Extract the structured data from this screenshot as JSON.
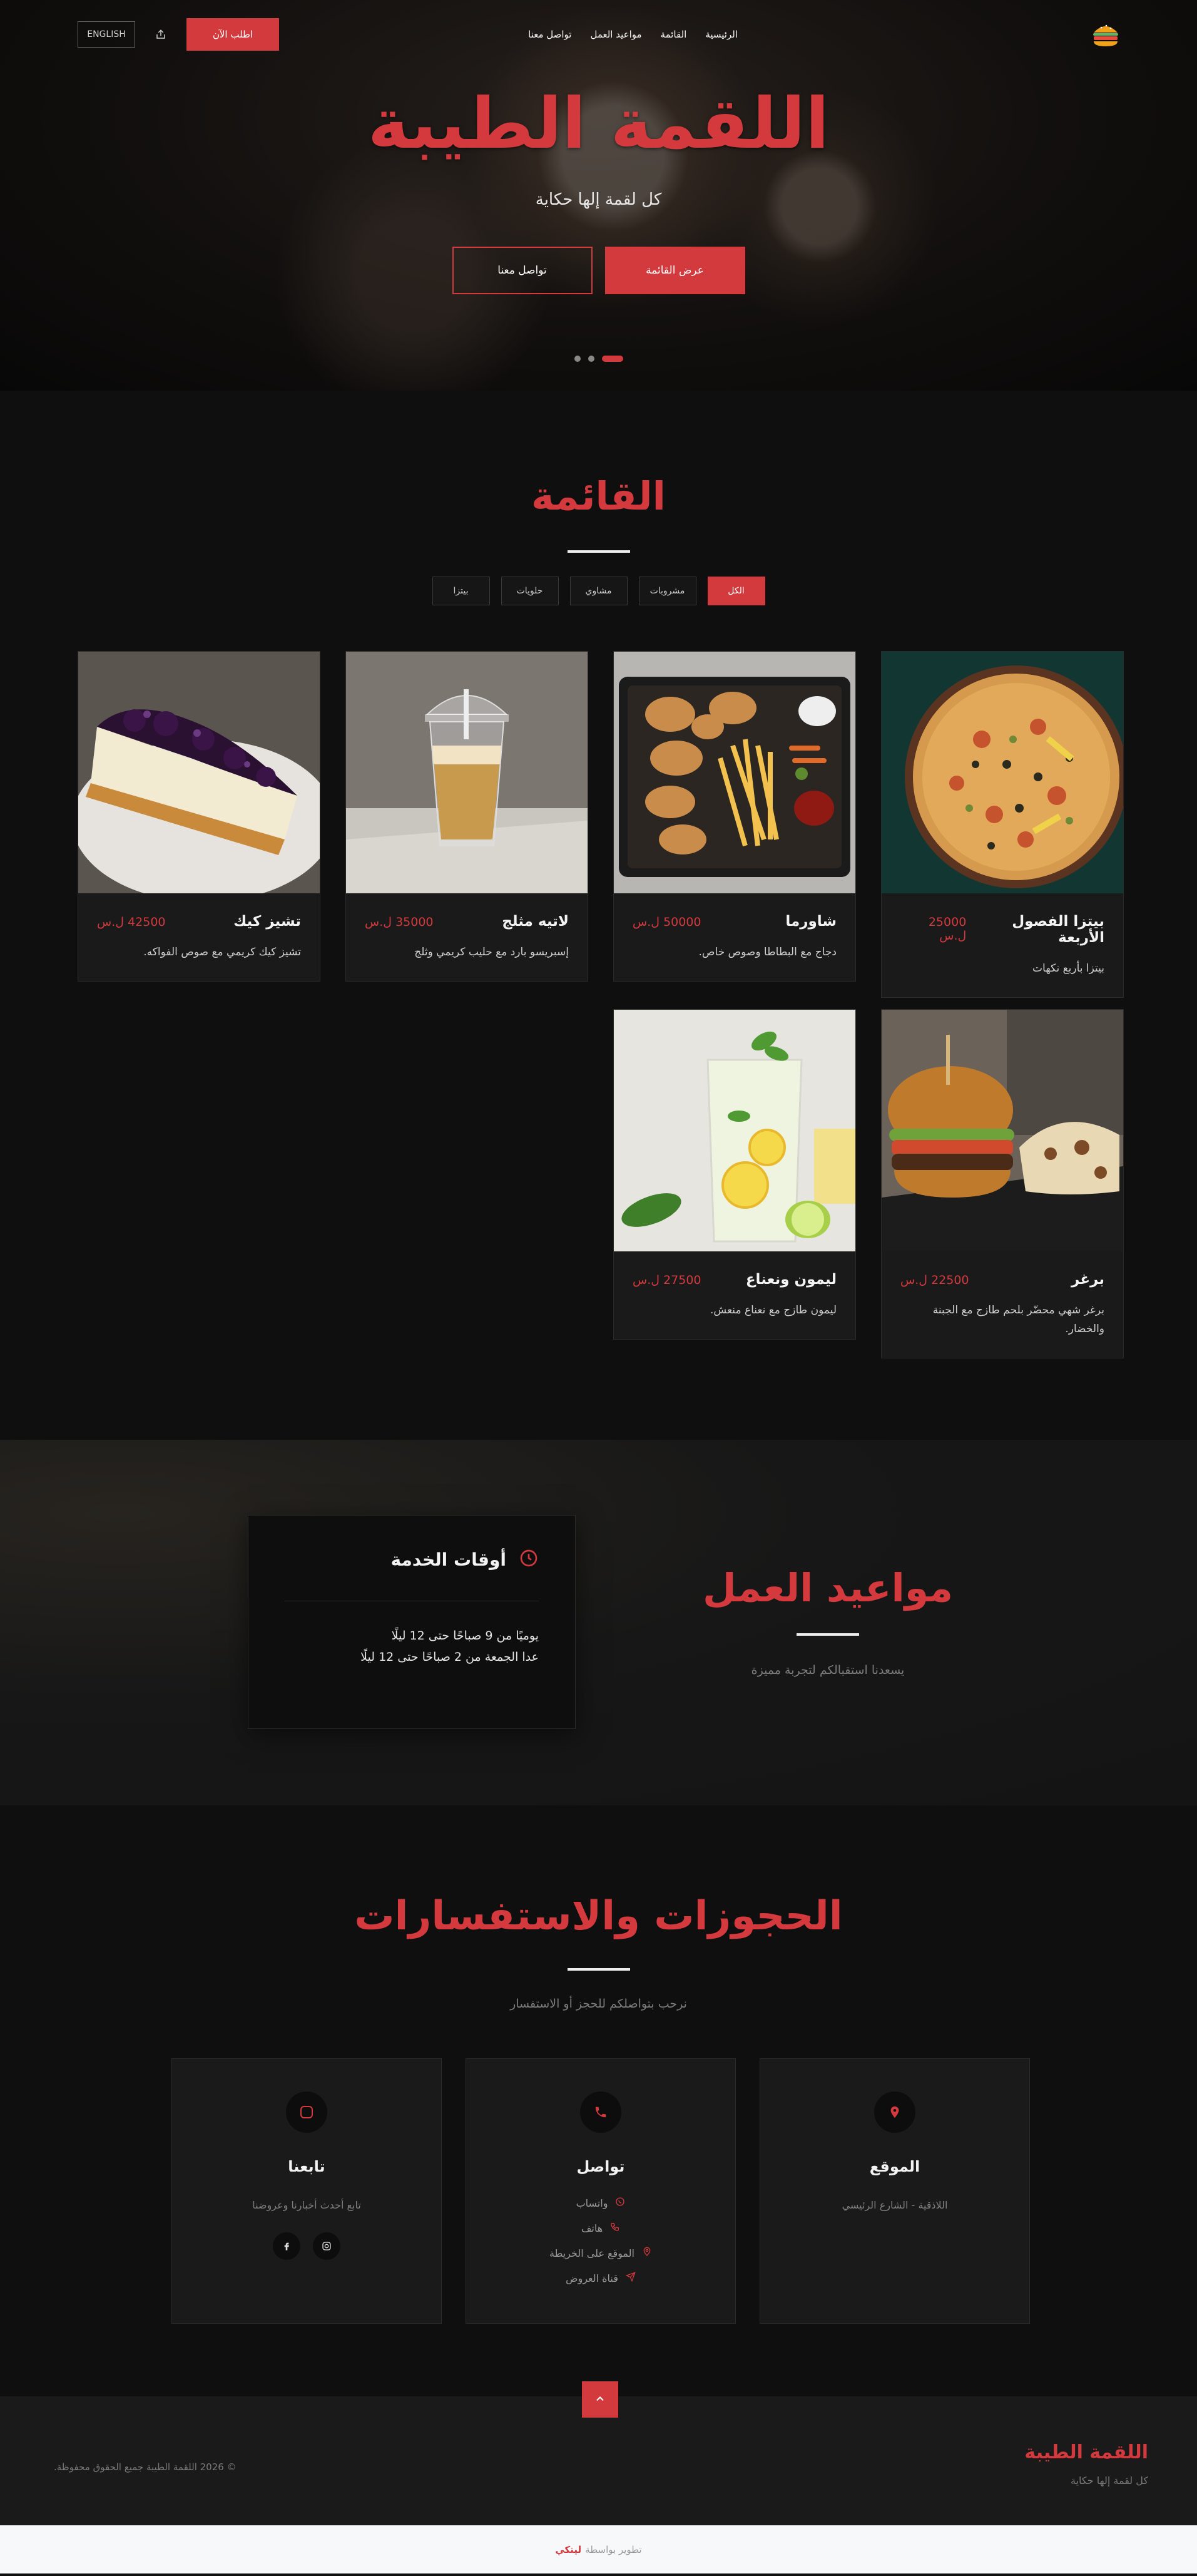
{
  "nav": {
    "links": [
      "الرئيسية",
      "القائمة",
      "مواعيد العمل",
      "تواصل معنا"
    ],
    "order_label": "اطلب الآن",
    "lang_label": "ENGLISH"
  },
  "hero": {
    "title": "اللقمة الطيبة",
    "subtitle": "كل لقمة إلها حكاية",
    "primary_btn": "عرض القائمة",
    "secondary_btn": "تواصل معنا"
  },
  "menu": {
    "title": "القائمة",
    "filters": [
      "الكل",
      "مشروبات",
      "مشاوي",
      "حلويات",
      "بيتزا"
    ],
    "active_filter": "الكل",
    "items": [
      {
        "name": "بيتزا الفصول الأربعة",
        "price": "25000 ل.س",
        "desc": "بيتزا بأربع نكهات"
      },
      {
        "name": "شاورما",
        "price": "50000 ل.س",
        "desc": "دجاج مع البطاطا وصوص خاص."
      },
      {
        "name": "لاتيه مثلج",
        "price": "35000 ل.س",
        "desc": "إسبريسو بارد مع حليب كريمي وثلج"
      },
      {
        "name": "تشيز كيك",
        "price": "42500 ل.س",
        "desc": "تشيز كيك كريمي مع صوص الفواكه."
      },
      {
        "name": "برغر",
        "price": "22500 ل.س",
        "desc": "برغر شهي محضّر بلحم طازج مع الجبنة والخضار."
      },
      {
        "name": "ليمون ونعناع",
        "price": "27500 ل.س",
        "desc": "ليمون طازج مع نعناع منعش."
      }
    ]
  },
  "hours": {
    "title": "مواعيد العمل",
    "subtitle": "يسعدنا استقبالكم لتجربة مميزة",
    "card_title": "أوقات الخدمة",
    "lines": [
      "يوميًا من 9 صباحًا حتى 12 ليلًا",
      "عدا الجمعة من 2 صباحًا حتى 12 ليلًا"
    ]
  },
  "contact": {
    "title": "الحجوزات والاستفسارات",
    "subtitle": "نرحب بتواصلكم للحجز أو الاستفسار",
    "location": {
      "title": "الموقع",
      "text": "اللاذقية - الشارع الرئيسي"
    },
    "reach": {
      "title": "تواصل",
      "items": [
        "واتساب",
        "هاتف",
        "الموقع على الخريطة",
        "قناة العروض"
      ]
    },
    "follow": {
      "title": "تابعنا",
      "text": "تابع أحدث أخبارنا وعروضنا"
    }
  },
  "footer": {
    "brand": "اللقمة الطيبة",
    "tagline": "كل لقمة إلها حكاية",
    "copyright": "© 2026 اللقمة الطيبة جميع الحقوق محفوظة.",
    "credit_prefix": "تطوير بواسطة",
    "credit_brand": "ليتكي"
  },
  "colors": {
    "accent": "#d3393d",
    "bg": "#0f0f10",
    "card": "#1a1a1b"
  },
  "icons": [
    "burger-logo-icon",
    "share-icon",
    "clock-icon",
    "map-pin-icon",
    "phone-icon",
    "instagram-icon",
    "facebook-icon",
    "whatsapp-icon",
    "send-icon",
    "chevron-up-icon"
  ]
}
